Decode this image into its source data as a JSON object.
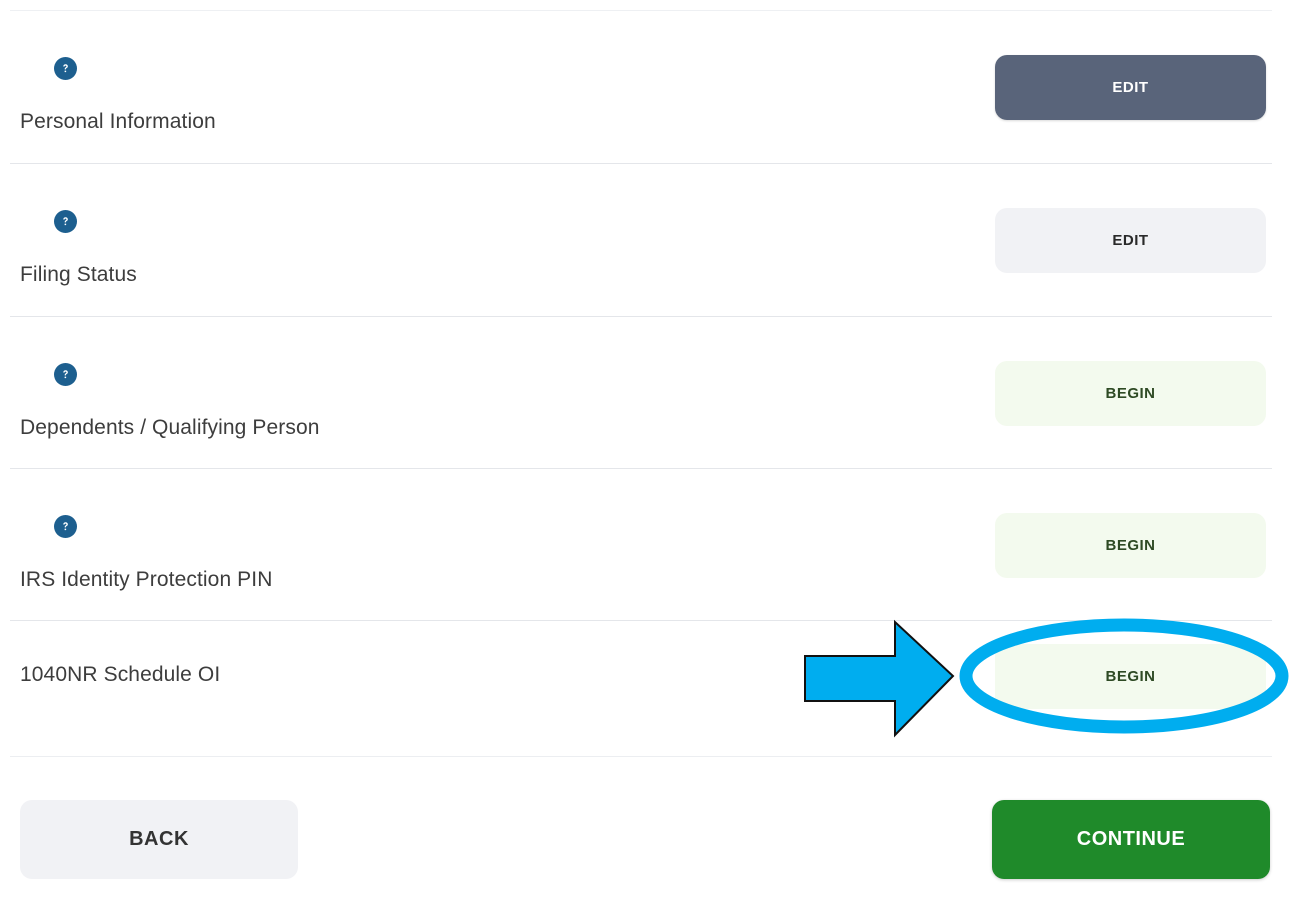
{
  "sections": [
    {
      "label": "Personal Information",
      "action": "EDIT",
      "has_help": true
    },
    {
      "label": "Filing Status",
      "action": "EDIT",
      "has_help": true
    },
    {
      "label": "Dependents / Qualifying Person",
      "action": "BEGIN",
      "has_help": true
    },
    {
      "label": "IRS Identity Protection PIN",
      "action": "BEGIN",
      "has_help": true
    },
    {
      "label": "1040NR Schedule OI",
      "action": "BEGIN",
      "has_help": false
    }
  ],
  "nav": {
    "back_label": "BACK",
    "continue_label": "CONTINUE"
  },
  "colors": {
    "help_icon": "#1d5f8f",
    "edit_primary_bg": "#59647a",
    "edit_secondary_bg": "#f1f2f5",
    "begin_bg": "#f3faee",
    "continue_bg": "#1f8a2a",
    "annotation": "#00adef"
  },
  "icons": {
    "help": "question-circle-icon",
    "annotation_arrow": "right-arrow-icon",
    "annotation_highlight": "ellipse-highlight"
  }
}
